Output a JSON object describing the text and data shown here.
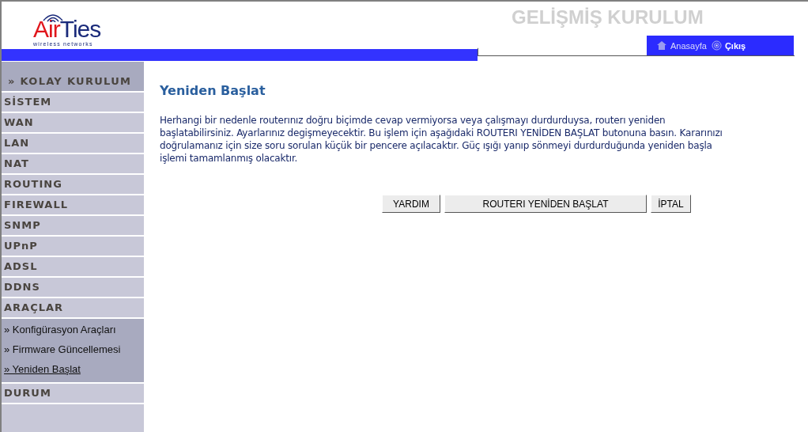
{
  "header": {
    "logo_part_1": "Air",
    "logo_part_2": "Ties",
    "logo_tagline": "wireless networks",
    "title": "GELİŞMİŞ KURULUM",
    "links": [
      {
        "kind": "home",
        "label": "Anasayfa"
      },
      {
        "kind": "exit",
        "label": "Çıkış"
      }
    ]
  },
  "sidebar": {
    "items": [
      {
        "label": "» KOLAY KURULUM",
        "kind": "top"
      },
      {
        "label": "SİSTEM",
        "kind": "section"
      },
      {
        "label": "WAN",
        "kind": "section"
      },
      {
        "label": "LAN",
        "kind": "section"
      },
      {
        "label": "NAT",
        "kind": "section"
      },
      {
        "label": "ROUTING",
        "kind": "section"
      },
      {
        "label": "FIREWALL",
        "kind": "section"
      },
      {
        "label": "SNMP",
        "kind": "section"
      },
      {
        "label": "UPnP",
        "kind": "section"
      },
      {
        "label": "ADSL",
        "kind": "section"
      },
      {
        "label": "DDNS",
        "kind": "section"
      },
      {
        "label": "ARAÇLAR",
        "kind": "section",
        "children": [
          {
            "label": "» Konfigürasyon Araçları",
            "selected": false
          },
          {
            "label": "» Firmware Güncellemesi",
            "selected": false
          },
          {
            "label": "» Yeniden Başlat",
            "selected": true
          }
        ]
      },
      {
        "label": "DURUM",
        "kind": "section"
      }
    ]
  },
  "content": {
    "title": "Yeniden Başlat",
    "text": "Herhangi bir nedenle routerınız doğru biçimde cevap vermiyorsa veya çalışmayı durdurduysa, routerı yeniden başlatabilirsiniz. Ayarlarınız degişmeyecektir. Bu işlem için aşağıdaki ROUTERI YENİDEN BAŞLAT butonuna basın. Kararınızı doğrulamanız için size soru sorulan küçük bir pencere açılacaktır. Güç ışığı yanıp sönmeyi durdurduğunda yeniden başla işlemi tamamlanmış olacaktır.",
    "buttons": [
      "YARDIM",
      "ROUTERI YENİDEN BAŞLAT",
      "İPTAL"
    ]
  }
}
